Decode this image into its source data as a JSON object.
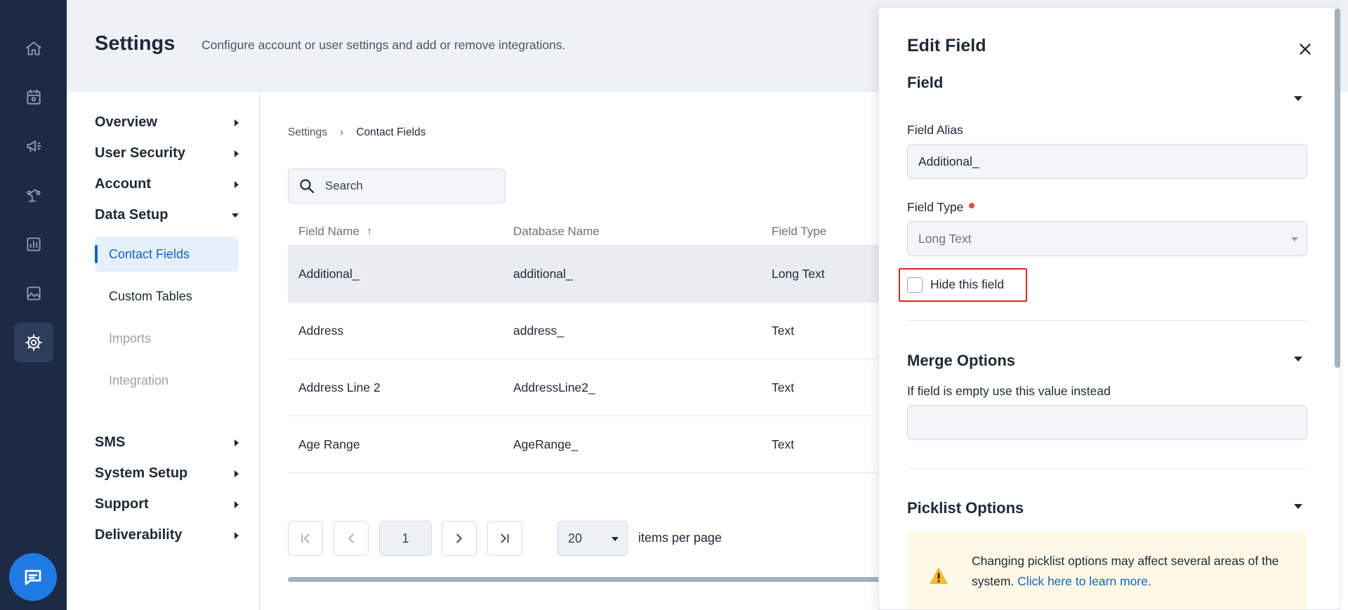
{
  "header": {
    "title": "Settings",
    "subtitle": "Configure account or user settings and add or remove integrations."
  },
  "rail": {
    "icons": [
      "home-icon",
      "calendar-icon",
      "megaphone-icon",
      "automation-icon",
      "reports-icon",
      "image-icon",
      "gear-icon"
    ],
    "active": "gear-icon",
    "chat": "chat-icon"
  },
  "settings_nav": {
    "sections": [
      {
        "label": "Overview",
        "expanded": false
      },
      {
        "label": "User Security",
        "expanded": false
      },
      {
        "label": "Account",
        "expanded": false
      },
      {
        "label": "Data Setup",
        "expanded": true
      },
      {
        "label": "SMS",
        "expanded": false
      },
      {
        "label": "System Setup",
        "expanded": false
      },
      {
        "label": "Support",
        "expanded": false
      },
      {
        "label": "Deliverability",
        "expanded": false
      }
    ],
    "data_setup_items": [
      {
        "label": "Contact Fields",
        "state": "active"
      },
      {
        "label": "Custom Tables",
        "state": "normal"
      },
      {
        "label": "Imports",
        "state": "muted"
      },
      {
        "label": "Integration",
        "state": "muted"
      }
    ]
  },
  "breadcrumb": {
    "root": "Settings",
    "separator": "›",
    "current": "Contact Fields"
  },
  "search": {
    "placeholder": "Search",
    "value": ""
  },
  "table": {
    "columns": [
      "Field Name",
      "Database Name",
      "Field Type"
    ],
    "sort_indicator": "↑",
    "rows": [
      {
        "field_name": "Additional_",
        "database_name": "additional_",
        "field_type": "Long Text",
        "selected": true
      },
      {
        "field_name": "Address",
        "database_name": "address_",
        "field_type": "Text",
        "selected": false
      },
      {
        "field_name": "Address Line 2",
        "database_name": "AddressLine2_",
        "field_type": "Text",
        "selected": false
      },
      {
        "field_name": "Age Range",
        "database_name": "AgeRange_",
        "field_type": "Text",
        "selected": false
      }
    ]
  },
  "pager": {
    "page": "1",
    "page_size": "20",
    "page_size_label": "items per page"
  },
  "edit_panel": {
    "title": "Edit Field",
    "field_section": {
      "title": "Field",
      "alias_label": "Field Alias",
      "alias_value": "Additional_",
      "type_label": "Field Type",
      "type_value": "Long Text",
      "hide_label": "Hide this field",
      "hide_checked": false
    },
    "merge_section": {
      "title": "Merge Options",
      "empty_label": "If field is empty use this value instead",
      "empty_value": ""
    },
    "picklist_section": {
      "title": "Picklist Options",
      "warning_text": "Changing picklist options may affect several areas of the system.",
      "warning_link": "Click here to learn more."
    }
  },
  "colors": {
    "rail": "#1c2a44",
    "accent": "#1565c0",
    "highlight_border": "#e02424",
    "warning_bg": "#fff8e6"
  }
}
